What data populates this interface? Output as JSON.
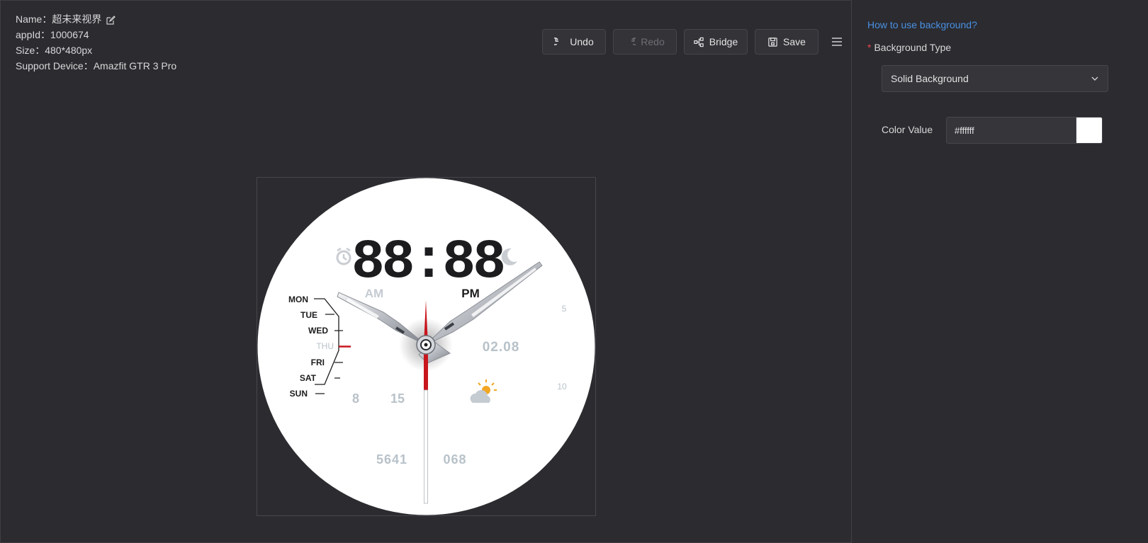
{
  "info": {
    "name_label": "Name：",
    "name_value": "超未来视界",
    "appid_label": "appId：",
    "appid_value": "1000674",
    "size_label": "Size：",
    "size_value": "480*480px",
    "device_label": "Support Device：",
    "device_value": "Amazfit GTR 3 Pro"
  },
  "toolbar": {
    "undo": "Undo",
    "redo": "Redo",
    "bridge": "Bridge",
    "save": "Save"
  },
  "panel": {
    "help_link": "How to use background?",
    "background_type_label": "Background Type",
    "background_type_value": "Solid Background",
    "color_value_label": "Color Value",
    "color_value": "#ffffff"
  },
  "watch": {
    "digital_time": "88:88",
    "am": "AM",
    "pm": "PM",
    "days": [
      "MON",
      "TUE",
      "WED",
      "THU",
      "FRI",
      "SAT",
      "SUN"
    ],
    "active_day": "THU",
    "date": "02.08",
    "left_num_1": "8",
    "left_num_2": "15",
    "steps": "5641",
    "heart": "068",
    "scale_5": "5",
    "scale_10": "10"
  },
  "colors": {
    "accent_link": "#4a90e2",
    "required_star": "#e5484d",
    "watch_bg": "#ffffff",
    "second_hand": "#c8161d"
  }
}
